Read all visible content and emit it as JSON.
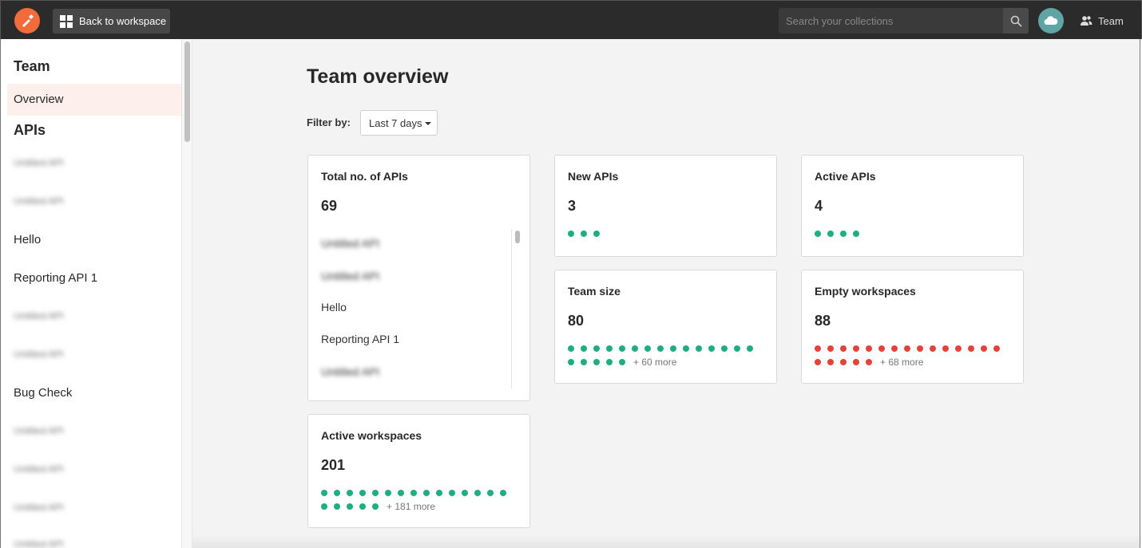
{
  "topbar": {
    "back_label": "Back to workspace",
    "search_placeholder": "Search your collections",
    "team_label": "Team"
  },
  "sidebar": {
    "team_heading": "Team",
    "overview_label": "Overview",
    "apis_heading": "APIs",
    "items": [
      {
        "label": "Untitled API",
        "blurred": true
      },
      {
        "label": "Untitled API",
        "blurred": true
      },
      {
        "label": "Hello",
        "blurred": false
      },
      {
        "label": "Reporting API 1",
        "blurred": false
      },
      {
        "label": "Untitled API",
        "blurred": true
      },
      {
        "label": "Untitled API",
        "blurred": true
      },
      {
        "label": "Bug Check",
        "blurred": false
      },
      {
        "label": "Untitled API",
        "blurred": true
      },
      {
        "label": "Untitled API",
        "blurred": true
      },
      {
        "label": "Untitled API",
        "blurred": true
      },
      {
        "label": "Untitled API",
        "blurred": true
      }
    ]
  },
  "main": {
    "title": "Team overview",
    "filter_label": "Filter by:",
    "filter_value": "Last 7 days"
  },
  "cards": {
    "total": {
      "title": "Total no. of APIs",
      "value": "69",
      "list": [
        {
          "label": "Untitled API",
          "blurred": true
        },
        {
          "label": "Untitled API",
          "blurred": true
        },
        {
          "label": "Hello",
          "blurred": false
        },
        {
          "label": "Reporting API 1",
          "blurred": false
        },
        {
          "label": "Untitled API",
          "blurred": true
        }
      ]
    },
    "new_apis": {
      "title": "New APIs",
      "value": "3",
      "dots": 3,
      "color": "green",
      "more": ""
    },
    "active_apis": {
      "title": "Active APIs",
      "value": "4",
      "dots": 4,
      "color": "green",
      "more": ""
    },
    "team_size": {
      "title": "Team size",
      "value": "80",
      "dots": 20,
      "color": "green",
      "more": "+ 60 more"
    },
    "empty_workspaces": {
      "title": "Empty workspaces",
      "value": "88",
      "dots": 20,
      "color": "red",
      "more": "+ 68 more"
    },
    "active_workspaces": {
      "title": "Active workspaces",
      "value": "201",
      "dots": 20,
      "color": "green",
      "more": "+ 181 more"
    }
  },
  "colors": {
    "accent": "#f26b3a",
    "green_dot": "#1fae7e",
    "red_dot": "#e8413a",
    "topbar": "#2b2b2b"
  }
}
